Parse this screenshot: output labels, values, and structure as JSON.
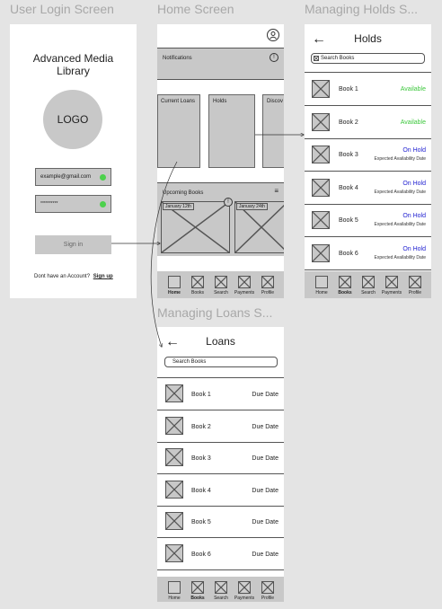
{
  "frames": {
    "login_title": "User Login Screen",
    "home_title": "Home Screen",
    "holds_title": "Managing Holds S...",
    "loans_title": "Managing Loans S..."
  },
  "login": {
    "app_title_line1": "Advanced Media",
    "app_title_line2": "Library",
    "logo": "LOGO",
    "email_value": "example@gmail.com",
    "password_value": "**********",
    "sign_in": "Sign in",
    "no_account": "Dont have an Account?",
    "sign_up": "Sign up"
  },
  "home": {
    "notifications": "Notifications",
    "cards": [
      "Current Loans",
      "Holds",
      "Discov"
    ],
    "upcoming_title": "Upcoming Books",
    "upcoming_dates": [
      "January 12th",
      "January 24th"
    ]
  },
  "holds": {
    "title": "Holds",
    "search_placeholder": "Search Books",
    "rows": [
      {
        "name": "Book 1",
        "status": "Available",
        "sub": ""
      },
      {
        "name": "Book 2",
        "status": "Available",
        "sub": ""
      },
      {
        "name": "Book 3",
        "status": "On Hold",
        "sub": "Expected Availability Date"
      },
      {
        "name": "Book 4",
        "status": "On Hold",
        "sub": "Expected Availability Date"
      },
      {
        "name": "Book 5",
        "status": "On Hold",
        "sub": "Expected Availability Date"
      },
      {
        "name": "Book 6",
        "status": "On Hold",
        "sub": "Expected Availability Date"
      }
    ]
  },
  "loans": {
    "title": "Loans",
    "search_placeholder": "Search Books",
    "rows": [
      {
        "name": "Book 1",
        "due": "Due Date"
      },
      {
        "name": "Book 2",
        "due": "Due Date"
      },
      {
        "name": "Book 3",
        "due": "Due Date"
      },
      {
        "name": "Book 4",
        "due": "Due Date"
      },
      {
        "name": "Book 5",
        "due": "Due Date"
      },
      {
        "name": "Book 6",
        "due": "Due Date"
      }
    ]
  },
  "nav": [
    "Home",
    "Books",
    "Search",
    "Payments",
    "Profile"
  ],
  "colors": {
    "available": "#3ec83e",
    "on_hold": "#1f1fd0",
    "wire_gray": "#c8c8c8",
    "toggle_green": "#4cd14c"
  }
}
